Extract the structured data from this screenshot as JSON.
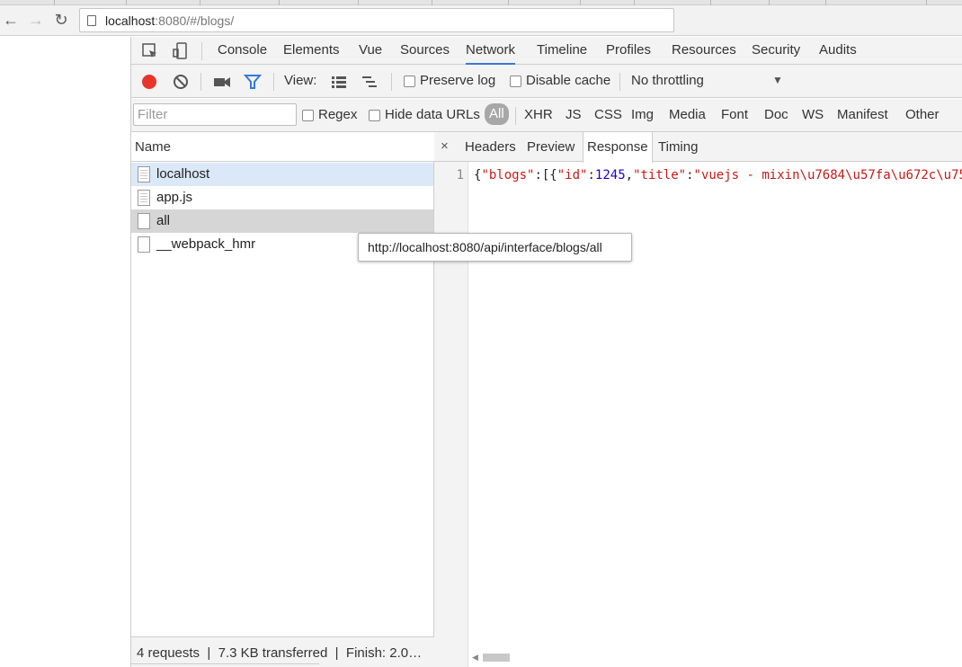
{
  "browser": {
    "url_host": "localhost",
    "url_rest": ":8080/#/blogs/"
  },
  "devtools": {
    "main_tabs": [
      "Console",
      "Elements",
      "Vue",
      "Sources",
      "Network",
      "Timeline",
      "Profiles",
      "Resources",
      "Security",
      "Audits"
    ],
    "active_tab": "Network",
    "toolbar": {
      "view_label": "View:",
      "preserve_log": "Preserve log",
      "disable_cache": "Disable cache",
      "throttling": "No throttling"
    },
    "filterbar": {
      "filter_placeholder": "Filter",
      "regex": "Regex",
      "hide_data_urls": "Hide data URLs",
      "types": [
        "All",
        "XHR",
        "JS",
        "CSS",
        "Img",
        "Media",
        "Font",
        "Doc",
        "WS",
        "Manifest",
        "Other"
      ]
    },
    "requests": {
      "header": "Name",
      "rows": [
        "localhost",
        "app.js",
        "all",
        "__webpack_hmr"
      ],
      "status": "4 requests  |  7.3 KB transferred  |  Finish: 2.0…"
    },
    "detail": {
      "close": "×",
      "tabs": [
        "Headers",
        "Preview",
        "Response",
        "Timing"
      ],
      "active_tab": "Response",
      "line_number": "1",
      "code_punct_open": "{",
      "code_key1": "\"blogs\"",
      "code_mid1": ":[{",
      "code_key2": "\"id\"",
      "code_colon": ":",
      "code_num": "1245",
      "code_comma": ",",
      "code_key3": "\"title\"",
      "code_colon2": ":",
      "code_val": "\"vuejs - mixin\\u7684\\u57fa\\u672c\\u75"
    },
    "tooltip": "http://localhost:8080/api/interface/blogs/all"
  },
  "colors": {
    "record": "#e8352c",
    "accent": "#3879d9",
    "selected_row": "#dbe8f8"
  }
}
